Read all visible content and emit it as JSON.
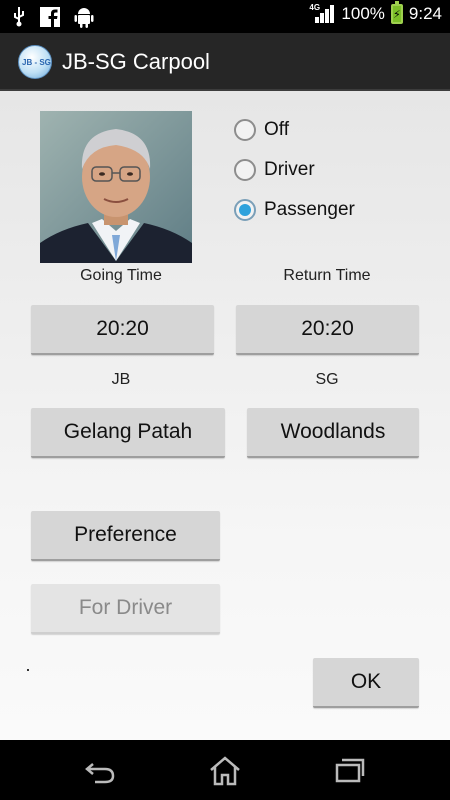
{
  "status_bar": {
    "network": "4G",
    "battery": "100%",
    "time": "9:24",
    "icons": [
      "usb-icon",
      "facebook-icon",
      "android-icon",
      "signal-icon",
      "battery-icon"
    ]
  },
  "app": {
    "title": "JB-SG Carpool",
    "icon_text": "JB - SG"
  },
  "mode_options": [
    {
      "label": "Off",
      "selected": false
    },
    {
      "label": "Driver",
      "selected": false
    },
    {
      "label": "Passenger",
      "selected": true
    }
  ],
  "going_time": {
    "label": "Going Time",
    "value": "20:20"
  },
  "return_time": {
    "label": "Return Time",
    "value": "20:20"
  },
  "jb": {
    "label": "JB",
    "value": "Gelang Patah"
  },
  "sg": {
    "label": "SG",
    "value": "Woodlands"
  },
  "buttons": {
    "preference": "Preference",
    "for_driver": "For Driver",
    "ok": "OK"
  },
  "colors": {
    "accent": "#2ea2dc",
    "actionbar": "#262626",
    "button": "#d6d6d6"
  }
}
